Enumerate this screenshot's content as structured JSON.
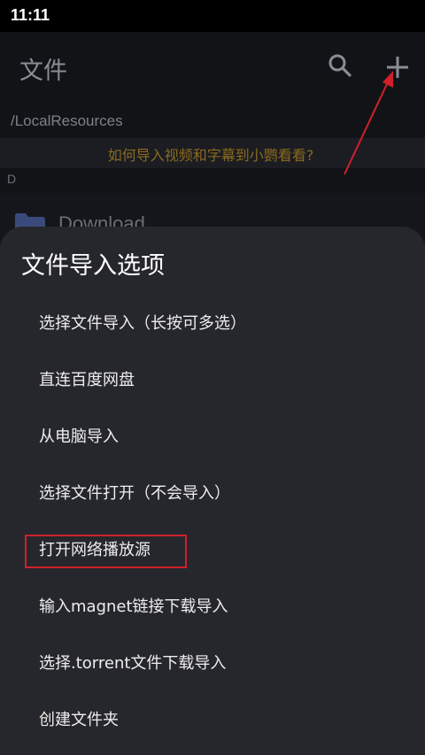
{
  "status_bar": {
    "time": "11:11"
  },
  "app_bar": {
    "title": "文件",
    "search_icon": "search-icon",
    "add_icon": "plus-icon"
  },
  "path": "/LocalResources",
  "help_banner": "如何导入视频和字幕到小鹦看看?",
  "section_header": "D",
  "files": [
    {
      "name": "Download",
      "icon": "folder-icon"
    }
  ],
  "sheet": {
    "title": "文件导入选项",
    "options": [
      {
        "label": "选择文件导入（长按可多选）"
      },
      {
        "label": "直连百度网盘"
      },
      {
        "label": "从电脑导入"
      },
      {
        "label": "选择文件打开（不会导入）"
      },
      {
        "label": "打开网络播放源"
      },
      {
        "label": "输入magnet链接下载导入"
      },
      {
        "label": "选择.torrent文件下载导入"
      },
      {
        "label": "创建文件夹"
      }
    ]
  },
  "colors": {
    "annotation": "#d0202a",
    "banner_text": "#8a6a1e",
    "sheet_bg": "#26272c",
    "app_bg": "#121317"
  }
}
